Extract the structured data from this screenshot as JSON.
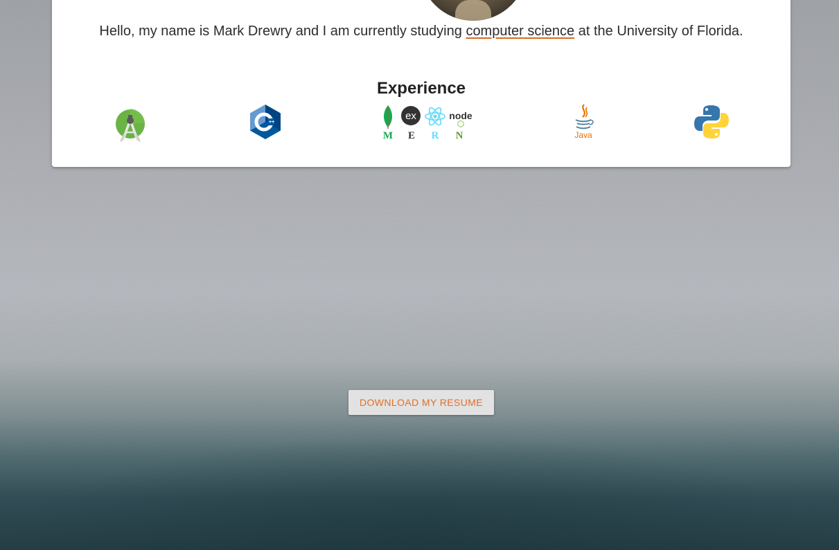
{
  "profile": {
    "intro_before": "Hello, my name is Mark Drewry and I am currently studying ",
    "intro_link": "computer science",
    "intro_after": " at the University of Florida."
  },
  "experience": {
    "title": "Experience",
    "icons": [
      {
        "name": "android-studio-icon"
      },
      {
        "name": "cpp-icon",
        "text": "C",
        "text_small": "++"
      },
      {
        "name": "mern-stack-icon",
        "text_ex": "ex",
        "text_node": "node",
        "letters": [
          "M",
          "E",
          "R",
          "N"
        ]
      },
      {
        "name": "java-icon",
        "text": "Java"
      },
      {
        "name": "python-icon"
      }
    ]
  },
  "actions": {
    "download_resume": "DOWNLOAD MY RESUME"
  },
  "colors": {
    "accent": "#e06e2a",
    "link_underline": "#d76a1e",
    "card_bg": "#ffffff",
    "button_bg": "#e2e2e2"
  }
}
